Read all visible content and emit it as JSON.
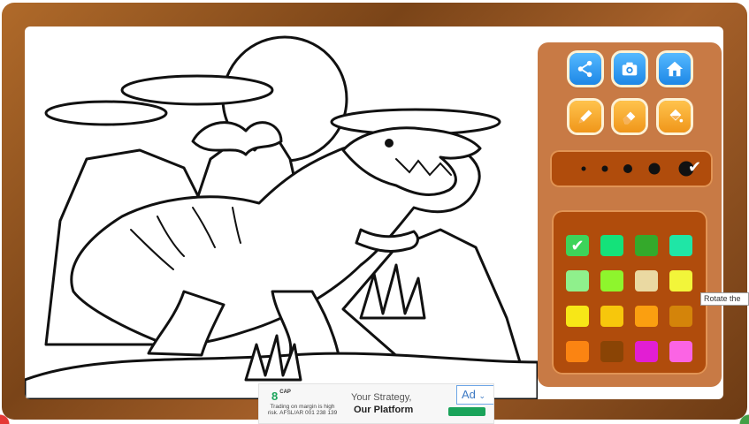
{
  "toolbar": {
    "share": "share-icon",
    "camera": "camera-icon",
    "home": "home-icon",
    "pencil": "pencil-icon",
    "eraser": "eraser-icon",
    "fill": "paint-bucket-icon"
  },
  "brush_sizes": {
    "count": 5,
    "selected_index": 4
  },
  "palette": {
    "selected_index": 0,
    "colors": [
      "#3dd45a",
      "#14e27a",
      "#34a92b",
      "#1fe6a6",
      "#8ff08c",
      "#8ef52d",
      "#ead9a2",
      "#f2f53a",
      "#f7e717",
      "#f7c70c",
      "#fb9f10",
      "#d4840a",
      "#fb8412",
      "#8a4405",
      "#e21ed3",
      "#fb64e4"
    ]
  },
  "tooltip": {
    "text": "Rotate the"
  },
  "ad": {
    "logo": "8",
    "logo_suffix": "CAP",
    "risk_text": "Trading on margin is high risk. AFSL/AR 001 238 139",
    "headline": "Your Strategy,",
    "subline": "Our Platform",
    "badge": "Ad"
  }
}
